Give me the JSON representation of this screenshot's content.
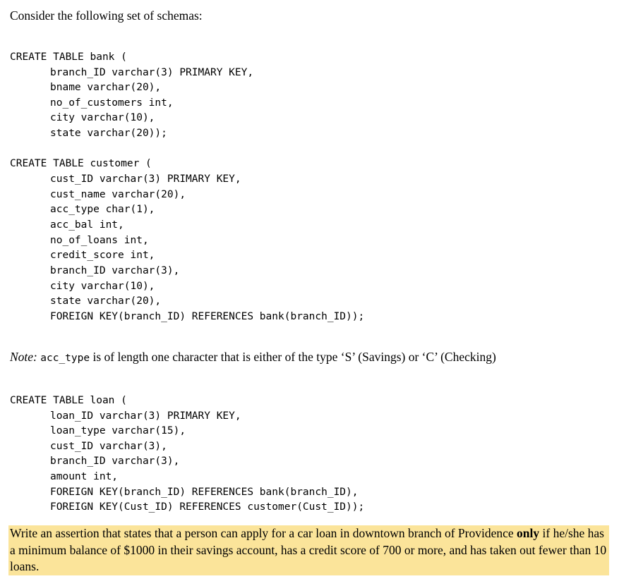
{
  "intro": "Consider the following set of schemas:",
  "bank": {
    "header": "CREATE TABLE bank (",
    "lines": [
      "branch_ID varchar(3) PRIMARY KEY,",
      "bname varchar(20),",
      "no_of_customers int,",
      "city varchar(10),",
      "state varchar(20));"
    ]
  },
  "customer": {
    "header": "CREATE TABLE customer (",
    "lines": [
      "cust_ID varchar(3) PRIMARY KEY,",
      "cust_name varchar(20),",
      "acc_type char(1),",
      "acc_bal int,",
      "no_of_loans int,",
      "credit_score int,",
      "branch_ID varchar(3),",
      "city varchar(10),",
      "state varchar(20),",
      "FOREIGN KEY(branch_ID) REFERENCES bank(branch_ID));"
    ]
  },
  "note": {
    "label": "Note:",
    "code": "acc_type",
    "text": " is of length one character that is either of the type ‘S’ (Savings) or ‘C’ (Checking)"
  },
  "loan": {
    "header": "CREATE TABLE loan (",
    "lines": [
      "loan_ID varchar(3) PRIMARY KEY,",
      "loan_type varchar(15),",
      "cust_ID varchar(3),",
      "branch_ID varchar(3),",
      "amount int,",
      "FOREIGN KEY(branch_ID) REFERENCES bank(branch_ID),",
      "FOREIGN KEY(Cust_ID) REFERENCES customer(Cust_ID));"
    ]
  },
  "question": {
    "part1": "Write an assertion that states that a person can apply for a car loan in downtown branch of Providence ",
    "bold": "only",
    "part2": " if he/she has a minimum balance of $1000 in their savings account, has a credit score of 700 or more, and has taken out fewer than 10 loans.",
    "highlight_color": "#fbe49a"
  }
}
